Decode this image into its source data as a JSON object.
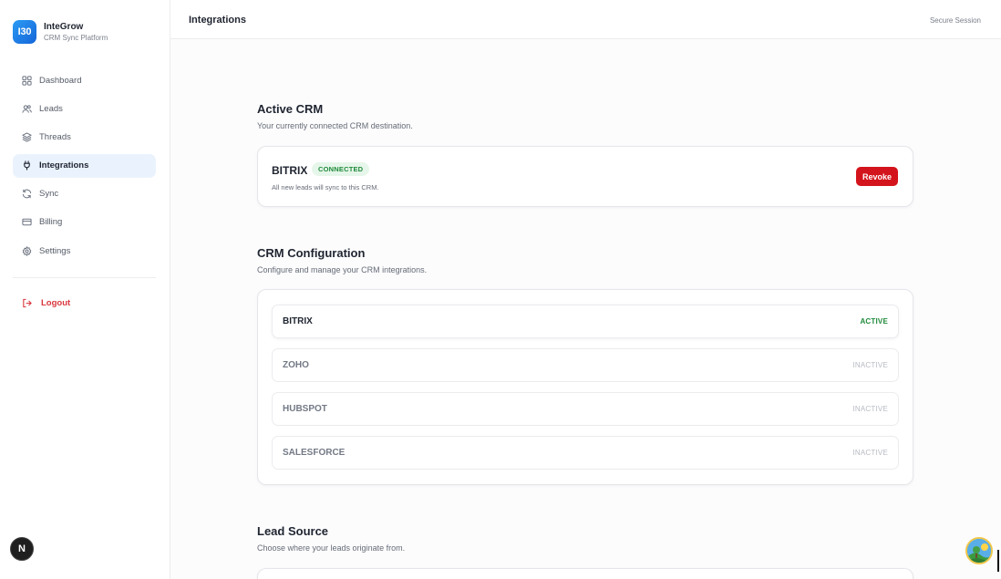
{
  "brand": {
    "logo_text": "I30",
    "name": "InteGrow",
    "subtitle": "CRM Sync Platform"
  },
  "sidebar": {
    "items": [
      {
        "label": "Dashboard",
        "icon": "grid-icon"
      },
      {
        "label": "Leads",
        "icon": "users-icon"
      },
      {
        "label": "Threads",
        "icon": "layers-icon"
      },
      {
        "label": "Integrations",
        "icon": "plug-icon",
        "active": true
      },
      {
        "label": "Sync",
        "icon": "refresh-icon"
      },
      {
        "label": "Billing",
        "icon": "credit-card-icon"
      },
      {
        "label": "Settings",
        "icon": "gear-icon"
      }
    ],
    "logout_label": "Logout"
  },
  "dev_badge": "N",
  "header": {
    "title": "Integrations",
    "session": "Secure Session"
  },
  "active_crm": {
    "title": "Active CRM",
    "subtitle": "Your currently connected CRM destination.",
    "crm_name": "BITRIX",
    "badge": "CONNECTED",
    "note": "All new leads will sync to this CRM.",
    "revoke_label": "Revoke"
  },
  "crm_config": {
    "title": "CRM Configuration",
    "subtitle": "Configure and manage your CRM integrations.",
    "rows": [
      {
        "name": "BITRIX",
        "status": "ACTIVE"
      },
      {
        "name": "ZOHO",
        "status": "INACTIVE"
      },
      {
        "name": "HUBSPOT",
        "status": "INACTIVE"
      },
      {
        "name": "SALESFORCE",
        "status": "INACTIVE"
      }
    ]
  },
  "lead_source": {
    "title": "Lead Source",
    "subtitle": "Choose where your leads originate from."
  },
  "colors": {
    "accent": "#2b9bf4",
    "active_nav_bg": "#eaf3fd",
    "success": "#1f8a3a",
    "danger": "#d4141c",
    "logout": "#d9363e"
  }
}
